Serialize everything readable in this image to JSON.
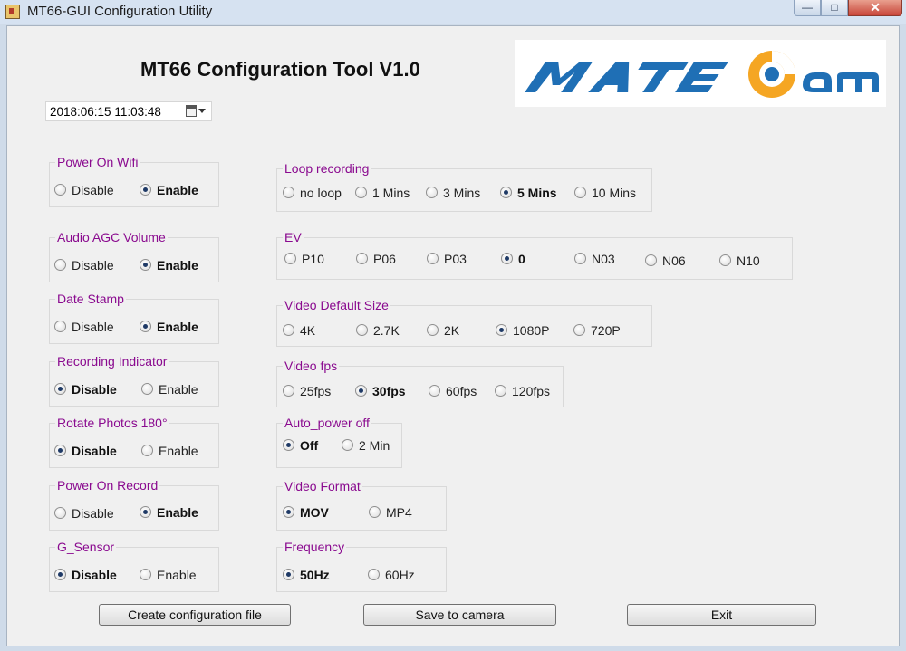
{
  "window": {
    "title": "MT66-GUI Configuration Utility"
  },
  "app": {
    "heading": "MT66 Configuration Tool V1.0",
    "logo_text": "MATE Cam"
  },
  "datetime": {
    "value": "2018:06:15 11:03:48"
  },
  "groups": {
    "power_on_wifi": {
      "label": "Power On Wifi",
      "options": [
        "Disable",
        "Enable"
      ],
      "selected": "Enable"
    },
    "audio_agc_volume": {
      "label": "Audio AGC Volume",
      "options": [
        "Disable",
        "Enable"
      ],
      "selected": "Enable"
    },
    "date_stamp": {
      "label": "Date Stamp",
      "options": [
        "Disable",
        "Enable"
      ],
      "selected": "Enable"
    },
    "recording_indicator": {
      "label": "Recording Indicator",
      "options": [
        "Disable",
        "Enable"
      ],
      "selected": "Disable"
    },
    "rotate_photos": {
      "label": "Rotate Photos 180°",
      "options": [
        "Disable",
        "Enable"
      ],
      "selected": "Disable"
    },
    "power_on_record": {
      "label": "Power On Record",
      "options": [
        "Disable",
        "Enable"
      ],
      "selected": "Enable"
    },
    "g_sensor": {
      "label": "G_Sensor",
      "options": [
        "Disable",
        "Enable"
      ],
      "selected": "Disable"
    },
    "loop_recording": {
      "label": "Loop recording",
      "options": [
        "no loop",
        "1 Mins",
        "3 Mins",
        "5 Mins",
        "10 Mins"
      ],
      "selected": "5 Mins"
    },
    "ev": {
      "label": "EV",
      "options": [
        "P10",
        "P06",
        "P03",
        "0",
        "N03",
        "N06",
        "N10"
      ],
      "selected": "0"
    },
    "video_default_size": {
      "label": "Video Default Size",
      "options": [
        "4K",
        "2.7K",
        "2K",
        "1080P",
        "720P"
      ],
      "selected": "1080P"
    },
    "video_fps": {
      "label": "Video fps",
      "options": [
        "25fps",
        "30fps",
        "60fps",
        "120fps"
      ],
      "selected": "30fps"
    },
    "auto_power_off": {
      "label": "Auto_power off",
      "options": [
        "Off",
        "2 Min"
      ],
      "selected": "Off"
    },
    "video_format": {
      "label": "Video Format",
      "options": [
        "MOV",
        "MP4"
      ],
      "selected": "MOV"
    },
    "frequency": {
      "label": "Frequency",
      "options": [
        "50Hz",
        "60Hz"
      ],
      "selected": "50Hz"
    }
  },
  "buttons": {
    "create": "Create configuration file",
    "save": "Save to camera",
    "exit": "Exit"
  },
  "colors": {
    "group_label": "#8a0a8f",
    "title_bar": "#d6e2f1",
    "logo_blue": "#1f6fb5",
    "logo_orange": "#f5a623"
  }
}
